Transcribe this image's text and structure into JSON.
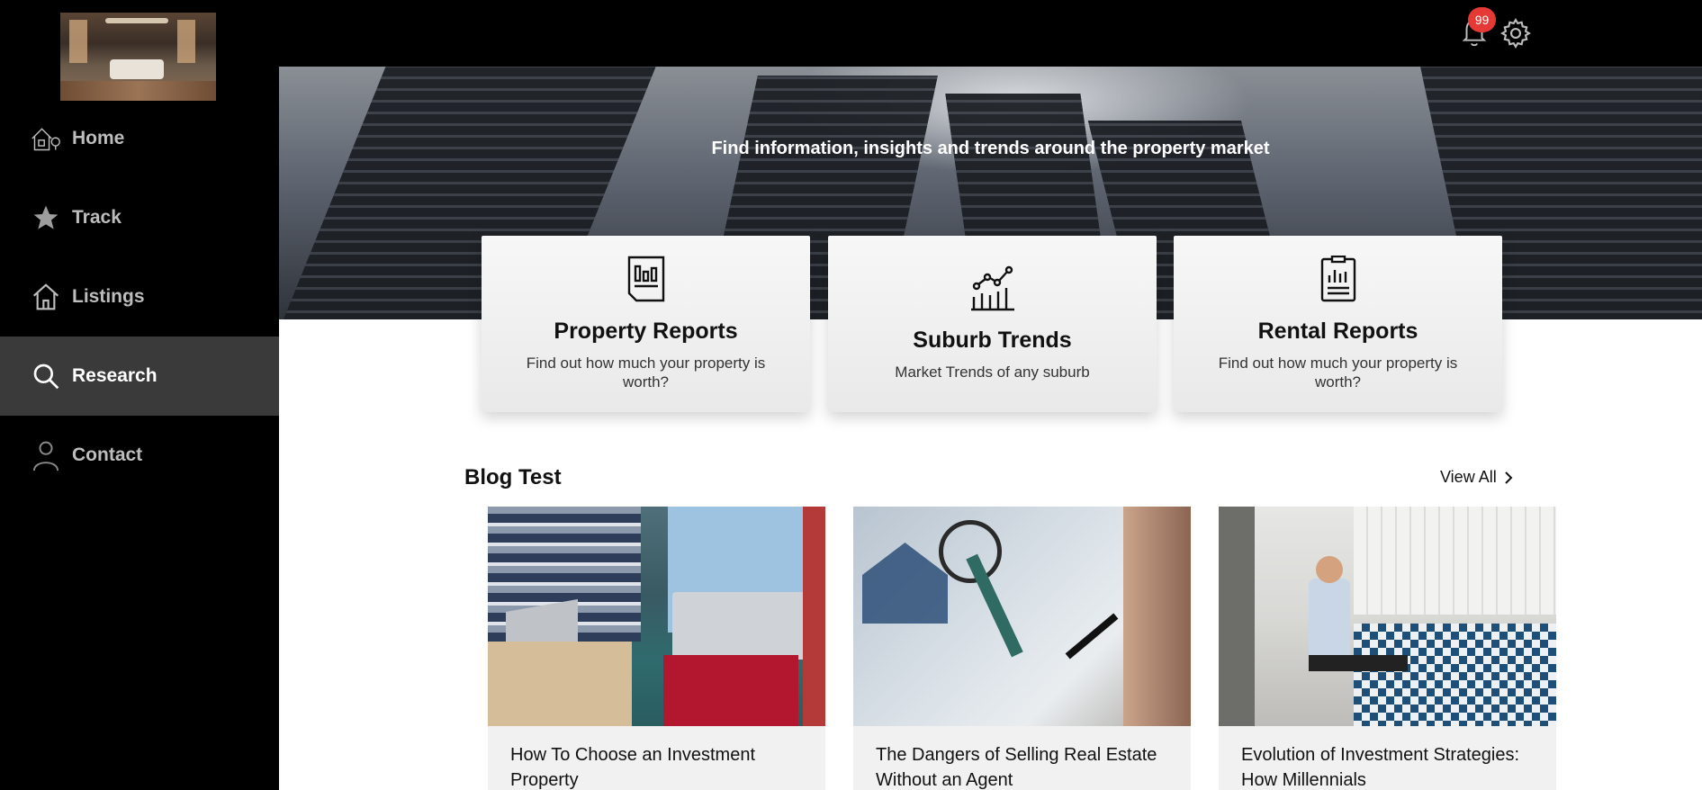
{
  "sidebar": {
    "items": [
      {
        "label": "Home",
        "icon": "home-tree-icon",
        "active": false
      },
      {
        "label": "Track",
        "icon": "star-icon",
        "active": false
      },
      {
        "label": "Listings",
        "icon": "house-icon",
        "active": false
      },
      {
        "label": "Research",
        "icon": "search-icon",
        "active": true
      },
      {
        "label": "Contact",
        "icon": "person-icon",
        "active": false
      }
    ]
  },
  "topbar": {
    "notifications_count": "99"
  },
  "hero": {
    "tagline": "Find information, insights and trends around the property market"
  },
  "cards": [
    {
      "title": "Property Reports",
      "description": "Find out how much your property is worth?",
      "icon": "report-document-icon"
    },
    {
      "title": "Suburb Trends",
      "description": "Market Trends of any suburb",
      "icon": "trend-chart-icon"
    },
    {
      "title": "Rental Reports",
      "description": "Find out how much your property is worth?",
      "icon": "clipboard-chart-icon"
    }
  ],
  "blog": {
    "title": "Blog Test",
    "view_all": "View All",
    "posts": [
      {
        "title": "How To Choose an Investment Property"
      },
      {
        "title": "The Dangers of Selling Real Estate Without an Agent"
      },
      {
        "title": "Evolution of Investment Strategies: How Millennials"
      }
    ]
  },
  "colors": {
    "badge": "#e53935",
    "active_nav": "#3a3a3a",
    "sidebar_bg": "#000000"
  }
}
